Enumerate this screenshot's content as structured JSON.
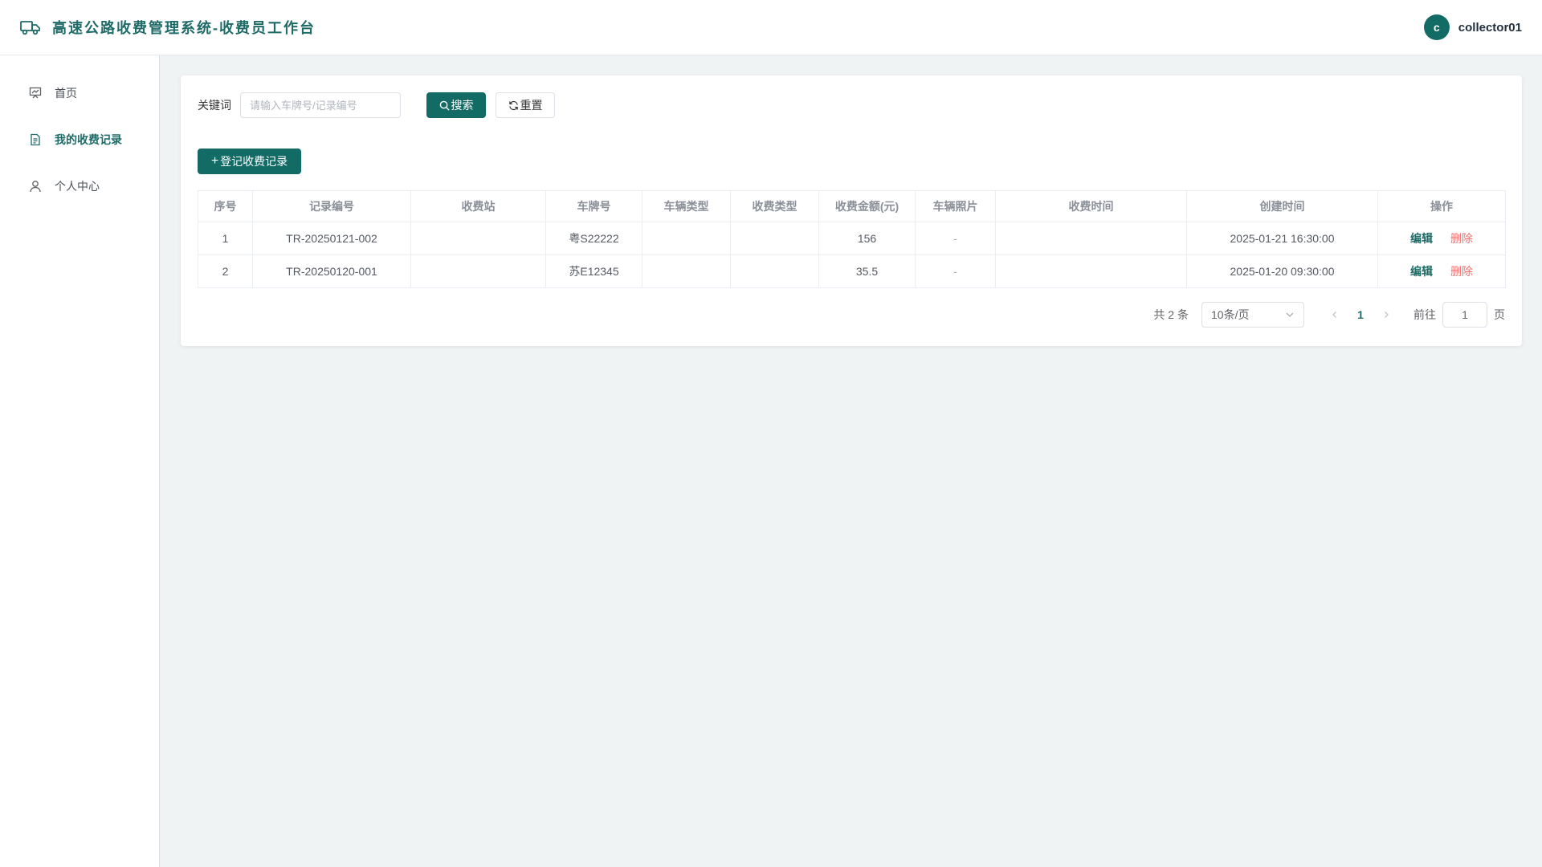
{
  "header": {
    "title": "高速公路收费管理系统-收费员工作台",
    "avatar_letter": "c",
    "username": "collector01"
  },
  "sidebar": {
    "items": [
      {
        "label": "首页",
        "icon": "dashboard-icon",
        "active": false
      },
      {
        "label": "我的收费记录",
        "icon": "document-icon",
        "active": true
      },
      {
        "label": "个人中心",
        "icon": "user-icon",
        "active": false
      }
    ]
  },
  "filter": {
    "keyword_label": "关键词",
    "keyword_placeholder": "请输入车牌号/记录编号",
    "keyword_value": "",
    "search_label": "搜索",
    "reset_label": "重置"
  },
  "toolbar": {
    "add_label": "登记收费记录"
  },
  "table": {
    "columns": [
      "序号",
      "记录编号",
      "收费站",
      "车牌号",
      "车辆类型",
      "收费类型",
      "收费金额(元)",
      "车辆照片",
      "收费时间",
      "创建时间",
      "操作"
    ],
    "rows": [
      {
        "index": "1",
        "record_no": "TR-20250121-002",
        "station": "",
        "plate": "粤S22222",
        "vehicle_type": "",
        "fee_type": "",
        "amount": "156",
        "photo": "-",
        "fee_time": "",
        "created": "2025-01-21 16:30:00"
      },
      {
        "index": "2",
        "record_no": "TR-20250120-001",
        "station": "",
        "plate": "苏E12345",
        "vehicle_type": "",
        "fee_type": "",
        "amount": "35.5",
        "photo": "-",
        "fee_time": "",
        "created": "2025-01-20 09:30:00"
      }
    ],
    "edit_label": "编辑",
    "delete_label": "删除"
  },
  "pagination": {
    "total_text": "共 2 条",
    "page_size": "10条/页",
    "current_page": "1",
    "goto_label": "前往",
    "goto_value": "1",
    "page_unit": "页"
  },
  "colors": {
    "primary": "#136b66",
    "danger": "#f56c6c",
    "background": "#eff3f4"
  }
}
